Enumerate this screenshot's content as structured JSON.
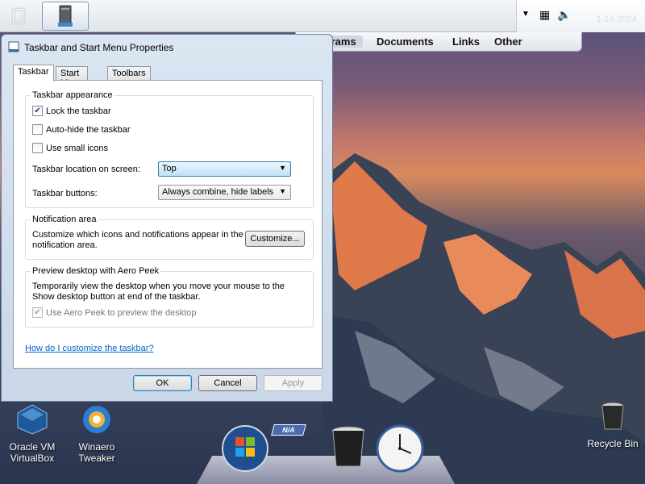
{
  "taskbar": {
    "start_icon": "apple-logo-icon",
    "task_button_icon": "pc-tower-icon",
    "tray": {
      "icons": [
        "chevron-down-icon",
        "network-icon",
        "speaker-muted-icon"
      ],
      "clock": "1-14-2024"
    }
  },
  "menubar": {
    "items": [
      "Programs",
      "Documents",
      "Links",
      "Other"
    ],
    "active_index": 0
  },
  "dialog": {
    "title": "Taskbar and Start Menu Properties",
    "tabs": [
      "Taskbar",
      "Start Menu",
      "Toolbars"
    ],
    "active_tab": 0,
    "appearance": {
      "title": "Taskbar appearance",
      "lock": {
        "label": "Lock the taskbar",
        "checked": true
      },
      "autohide": {
        "label": "Auto-hide the taskbar",
        "checked": false
      },
      "small_icons": {
        "label": "Use small icons",
        "checked": false
      },
      "location_label": "Taskbar location on screen:",
      "location_value": "Top",
      "buttons_label": "Taskbar buttons:",
      "buttons_value": "Always combine, hide labels"
    },
    "notification": {
      "title": "Notification area",
      "text": "Customize which icons and notifications appear in the notification area.",
      "button": "Customize..."
    },
    "peek": {
      "title": "Preview desktop with Aero Peek",
      "text": "Temporarily view the desktop when you move your mouse to the Show desktop button at end of the taskbar.",
      "checkbox": {
        "label": "Use Aero Peek to preview the desktop",
        "checked": true,
        "disabled": true
      }
    },
    "help_link": "How do I customize the taskbar?",
    "ok": "OK",
    "cancel": "Cancel",
    "apply": "Apply"
  },
  "desktop": {
    "icons": [
      {
        "label": "Oracle VM VirtualBox",
        "icon": "virtualbox-icon"
      },
      {
        "label": "Winaero Tweaker",
        "icon": "winaero-tweaker-icon"
      },
      {
        "label": "Recycle Bin",
        "icon": "recycle-bin-icon"
      }
    ]
  },
  "dock": {
    "badge": "N/A",
    "items": [
      "windows-orb-icon",
      "trash-can-icon",
      "clock-icon"
    ]
  },
  "colors": {
    "link": "#0066cc",
    "dialog_bg": "#dbe6f3",
    "accent_selected": "#c0e1f4"
  }
}
